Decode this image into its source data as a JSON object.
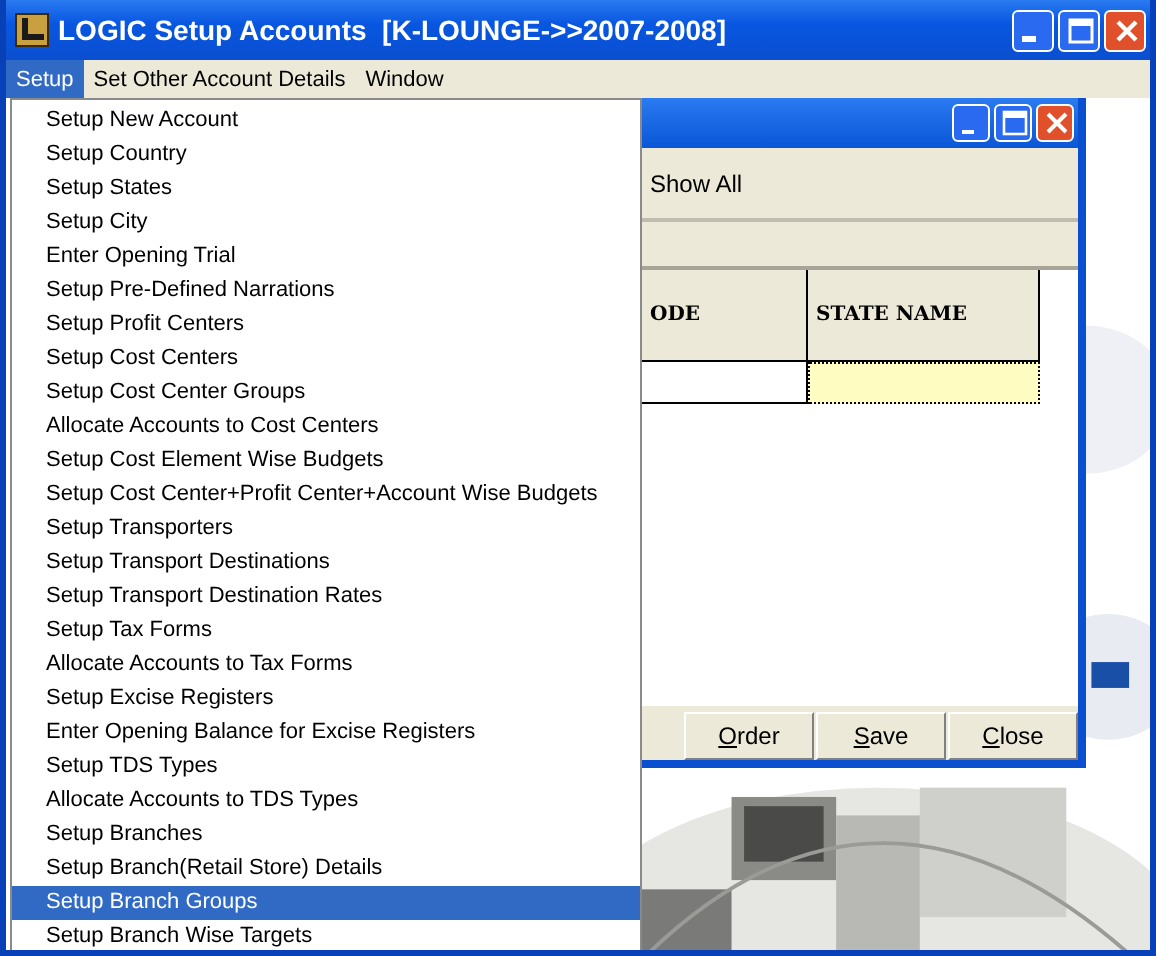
{
  "window": {
    "title": "LOGIC Setup Accounts  [K-LOUNGE->>2007-2008]"
  },
  "menu_bar": [
    {
      "label": "Setup",
      "selected": true
    },
    {
      "label": "Set Other Account Details",
      "selected": false
    },
    {
      "label": "Window",
      "selected": false
    }
  ],
  "setup_menu": [
    {
      "label": "Setup New Account",
      "selected": false
    },
    {
      "label": "Setup Country",
      "selected": false
    },
    {
      "label": "Setup States",
      "selected": false
    },
    {
      "label": "Setup City",
      "selected": false
    },
    {
      "label": "Enter Opening Trial",
      "selected": false
    },
    {
      "label": "Setup Pre-Defined Narrations",
      "selected": false
    },
    {
      "label": "Setup Profit Centers",
      "selected": false
    },
    {
      "label": "Setup Cost Centers",
      "selected": false
    },
    {
      "label": "Setup Cost Center Groups",
      "selected": false
    },
    {
      "label": "Allocate Accounts to Cost Centers",
      "selected": false
    },
    {
      "label": "Setup Cost Element Wise Budgets",
      "selected": false
    },
    {
      "label": "Setup Cost Center+Profit Center+Account Wise Budgets",
      "selected": false
    },
    {
      "label": "Setup Transporters",
      "selected": false
    },
    {
      "label": "Setup Transport Destinations",
      "selected": false
    },
    {
      "label": "Setup Transport Destination Rates",
      "selected": false
    },
    {
      "label": "Setup Tax Forms",
      "selected": false
    },
    {
      "label": "Allocate Accounts to Tax Forms",
      "selected": false
    },
    {
      "label": "Setup Excise Registers",
      "selected": false
    },
    {
      "label": "Enter Opening Balance for Excise Registers",
      "selected": false
    },
    {
      "label": "Setup TDS Types",
      "selected": false
    },
    {
      "label": "Allocate Accounts to TDS Types",
      "selected": false
    },
    {
      "label": "Setup Branches",
      "selected": false
    },
    {
      "label": "Setup Branch(Retail Store) Details",
      "selected": false
    },
    {
      "label": "Setup Branch Groups",
      "selected": true
    },
    {
      "label": "Setup Branch Wise Targets",
      "selected": false
    }
  ],
  "child_window": {
    "toolbar_text": "Show All",
    "grid": {
      "columns": [
        "ODE",
        "STATE NAME"
      ],
      "rows": [
        {
          "cells": [
            {
              "selected": false
            },
            {
              "selected": true
            }
          ]
        }
      ]
    },
    "buttons": [
      "Order",
      "Save",
      "Close"
    ]
  }
}
